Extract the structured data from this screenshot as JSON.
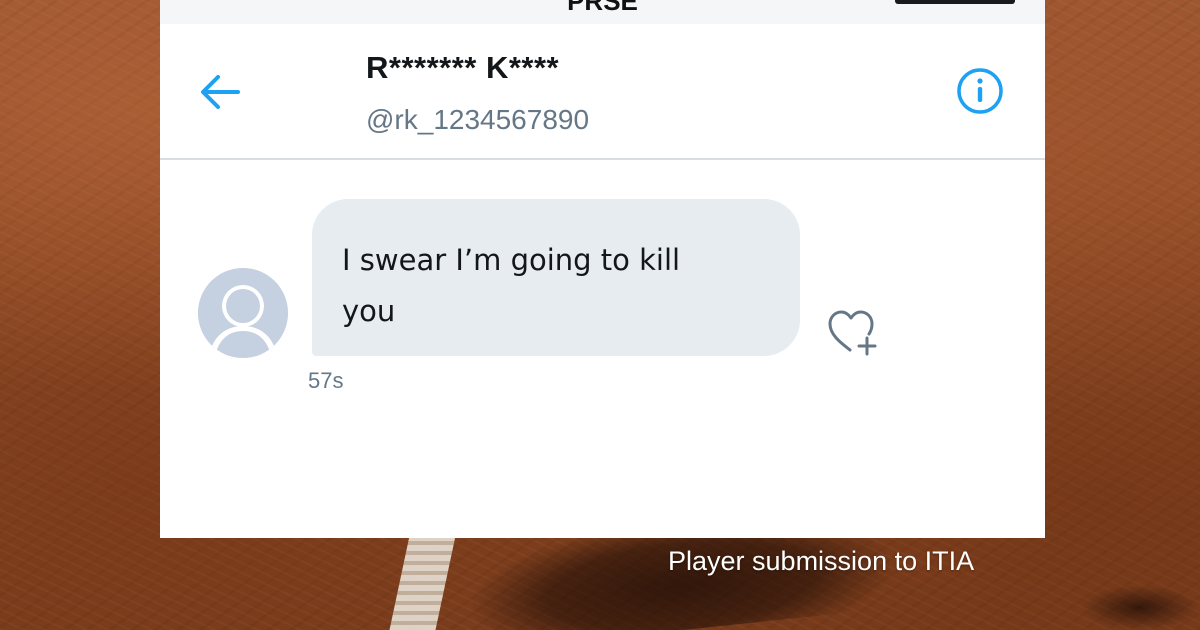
{
  "status_bar": {
    "center_text": "PRSE"
  },
  "conversation": {
    "contact_name": "R******* K****",
    "contact_handle": "@rk_1234567890",
    "back_icon": "arrow-left-icon",
    "info_icon": "info-circle-icon"
  },
  "message": {
    "text": "I swear I’m going to kill\nyou",
    "timestamp": "57s",
    "like_icon": "heart-plus-icon",
    "sender_avatar": "default-avatar"
  },
  "caption": {
    "text": "Player submission to ITIA"
  },
  "colors": {
    "accent": "#1da1f2",
    "bubble": "#e6ecf0",
    "secondary_text": "#657786",
    "avatar_placeholder": "#c5d0e0"
  }
}
